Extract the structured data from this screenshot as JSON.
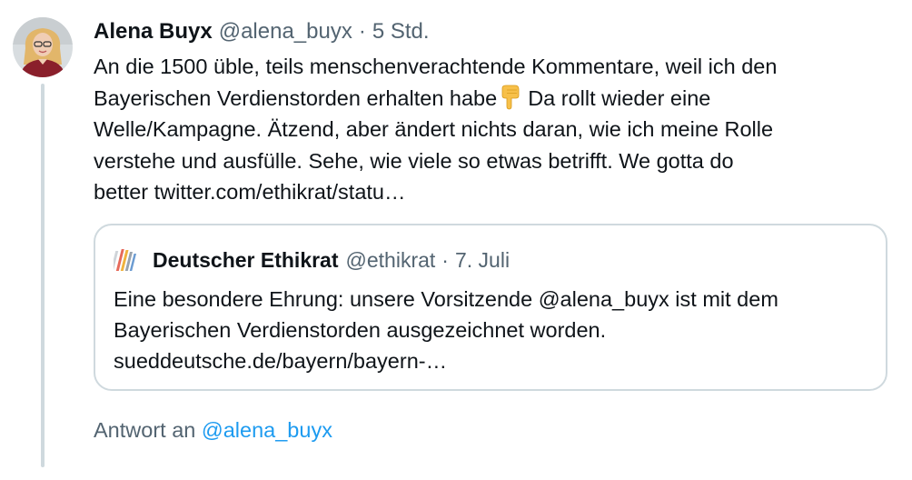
{
  "tweet": {
    "author": {
      "display_name": "Alena Buyx",
      "handle": "@alena_buyx",
      "avatar_icon": "profile-photo-avatar"
    },
    "separator": "·",
    "time": "5 Std.",
    "text": {
      "line1": "An die 1500 üble, teils menschenverachtende Kommentare, weil ich den",
      "line2_before_emoji": "Bayerischen Verdienstorden erhalten habe",
      "emoji_icon": "backhand-index-pointing-down-icon",
      "line2_after_emoji": "Da rollt wieder eine",
      "line3": "Welle/Kampagne. Ätzend, aber ändert nichts daran, wie ich meine Rolle",
      "line4": "verstehe und ausfülle. Sehe, wie viele so etwas betrifft. We gotta do",
      "line5_prefix": "better",
      "link": "twitter.com/ethikrat/statu…"
    },
    "quote": {
      "author": {
        "display_name": "Deutscher Ethikrat",
        "handle": "@ethikrat",
        "avatar_icon": "ethikrat-logo-icon"
      },
      "separator": "·",
      "time": "7. Juli",
      "text": {
        "line1": "Eine besondere Ehrung: unsere Vorsitzende @alena_buyx ist mit dem",
        "line2": "Bayerischen Verdienstorden ausgezeichnet worden.",
        "link": "sueddeutsche.de/bayern/bayern-…"
      }
    },
    "reply": {
      "prefix": "Antwort an",
      "handle": "@alena_buyx"
    }
  },
  "colors": {
    "text_primary": "#0f1419",
    "text_secondary": "#536471",
    "accent": "#1d9bf0",
    "border": "#cfd9de"
  }
}
